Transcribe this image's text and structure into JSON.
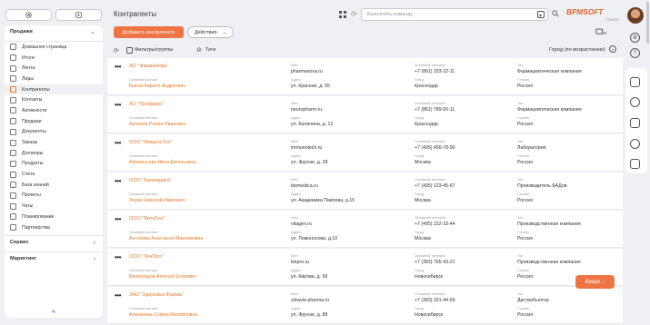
{
  "sidebar": {
    "section_title": "Продажи",
    "items": [
      {
        "label": "Домашняя страница"
      },
      {
        "label": "Итоги"
      },
      {
        "label": "Лента"
      },
      {
        "label": "Лиды"
      },
      {
        "label": "Контрагенты",
        "active": true
      },
      {
        "label": "Контакты"
      },
      {
        "label": "Активности"
      },
      {
        "label": "Продажи"
      },
      {
        "label": "Документы"
      },
      {
        "label": "Заказы"
      },
      {
        "label": "Договоры"
      },
      {
        "label": "Продукты"
      },
      {
        "label": "Счета"
      },
      {
        "label": "База знаний"
      },
      {
        "label": "Проекты"
      },
      {
        "label": "Чаты"
      },
      {
        "label": "Планирование"
      },
      {
        "label": "Партнерства"
      }
    ],
    "footer_sections": [
      {
        "label": "Сервис"
      },
      {
        "label": "Маркетинг"
      }
    ],
    "collapse_icon": "«"
  },
  "header": {
    "title": "Контрагенты",
    "command_placeholder": "Выполнить команду",
    "logo_text": "BPMSOFT",
    "logo_sub": "CRM/ERP",
    "add_button": "Добавить контрагента",
    "actions_button": "Действия",
    "profile_icon": "profile-icon"
  },
  "filters": {
    "filters_label": "Фильтры/группы",
    "tags_label": "Теги",
    "sort_label": "Город (по возрастанию)"
  },
  "captions": {
    "contact": "Основной контакт",
    "web": "Web",
    "address": "Адрес",
    "phone": "Основной телефон",
    "city": "Город",
    "type": "Тип",
    "country": "Страна"
  },
  "accounts": [
    {
      "name": "АО \"ФармаНова\"",
      "contact": "Быков Кирилл Андреевич",
      "web": "pharmanova.ru",
      "address": "ул. Красная, д. 55",
      "phone": "+7 (861) 333-22-11",
      "city": "Краснодар",
      "type": "Фармацевтическая компания",
      "country": "Россия"
    },
    {
      "name": "АО \"Профарм\"",
      "contact": "Артюхов Роман Иванович",
      "web": "neuropharm.ru",
      "address": "ул. Калинина, д. 12",
      "phone": "+7 (861) 789-00-11",
      "city": "Краснодар",
      "type": "Фармацевтическая компания",
      "country": "Россия"
    },
    {
      "name": "ООО \"ИммуноТех\"",
      "contact": "Афанасьева Нина Евгеньевна",
      "web": "immunotech.ru",
      "address": "ул. Фрунзе, д. 28",
      "phone": "+7 (495) 456-78-90",
      "city": "Москва",
      "type": "Лаборатория",
      "country": "Россия"
    },
    {
      "name": "ООО \"Биомедика\"",
      "contact": "Зорин Николай Иванович",
      "web": "biomedica.ru",
      "address": "ул. Академика Павлова, д.15",
      "phone": "+7 (495) 123-45-67",
      "city": "Москва",
      "type": "Производитель БАДов",
      "country": "Россия"
    },
    {
      "name": "ООО \"ВитаГен\"",
      "contact": "Антонова Анастасия Максимовна",
      "web": "vitagen.ru",
      "address": "ул. Ломоносова, д.10",
      "phone": "+7 (495) 222-33-44",
      "city": "Москва",
      "type": "Производственная компания",
      "country": "Россия"
    },
    {
      "name": "ООО \"ЛекПро\"",
      "contact": "Виноградов Алексей Егорович",
      "web": "lekpro.ru",
      "address": "ул. Кирова, д. 99",
      "phone": "+7 (383) 765-43-21",
      "city": "Новосибирск",
      "type": "Производственная компания",
      "country": "Россия"
    },
    {
      "name": "ЗАО \"Здоровья Фарма\"",
      "contact": "Алексеева София Михайловна",
      "web": "zdravie-pharma.ru",
      "address": "ул. Фрунзе, д. 89",
      "phone": "+7 (383) 321-44-55",
      "city": "Новосибирск",
      "type": "Дистрибьютор",
      "country": "Россия"
    }
  ],
  "back_to_top": "Вверх"
}
